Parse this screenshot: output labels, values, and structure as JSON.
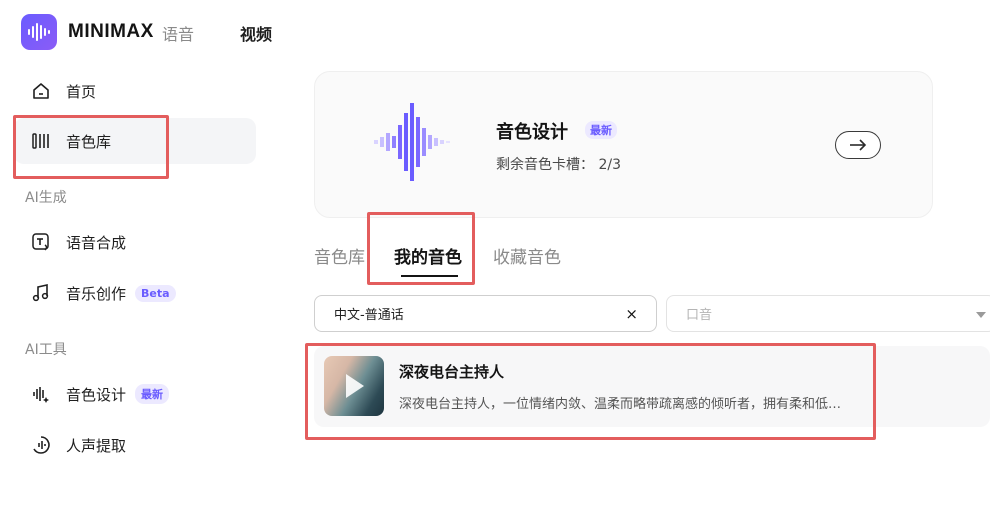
{
  "header": {
    "brand": "MINIMAX",
    "tabs": [
      "语音",
      "视频"
    ]
  },
  "sidebar": {
    "items_top": [
      {
        "label": "首页",
        "icon": "home-icon"
      },
      {
        "label": "音色库",
        "icon": "voice-library-icon",
        "active": true
      }
    ],
    "section_generate": "AI生成",
    "items_generate": [
      {
        "label": "语音合成",
        "icon": "text-to-speech-icon"
      },
      {
        "label": "音乐创作",
        "icon": "music-note-icon",
        "badge": "Beta"
      }
    ],
    "section_tools": "AI工具",
    "items_tools": [
      {
        "label": "音色设计",
        "icon": "voice-design-icon",
        "badge": "最新"
      },
      {
        "label": "人声提取",
        "icon": "vocal-extract-icon"
      }
    ]
  },
  "hero": {
    "title": "音色设计",
    "badge": "最新",
    "subtitle": "剩余音色卡槽： 2/3"
  },
  "tabs": [
    {
      "label": "音色库",
      "active": false
    },
    {
      "label": "我的音色",
      "active": true
    },
    {
      "label": "收藏音色",
      "active": false
    }
  ],
  "filters": {
    "language_value": "中文-普通话",
    "clear_symbol": "×",
    "accent_placeholder": "口音"
  },
  "voices": [
    {
      "name": "深夜电台主持人",
      "description": "深夜电台主持人，一位情绪内敛、温柔而略带疏离感的倾听者，拥有柔和低…"
    }
  ],
  "colors": {
    "accent": "#6a5cff",
    "badge_bg": "#ece9ff",
    "highlight": "#e35d5d"
  }
}
